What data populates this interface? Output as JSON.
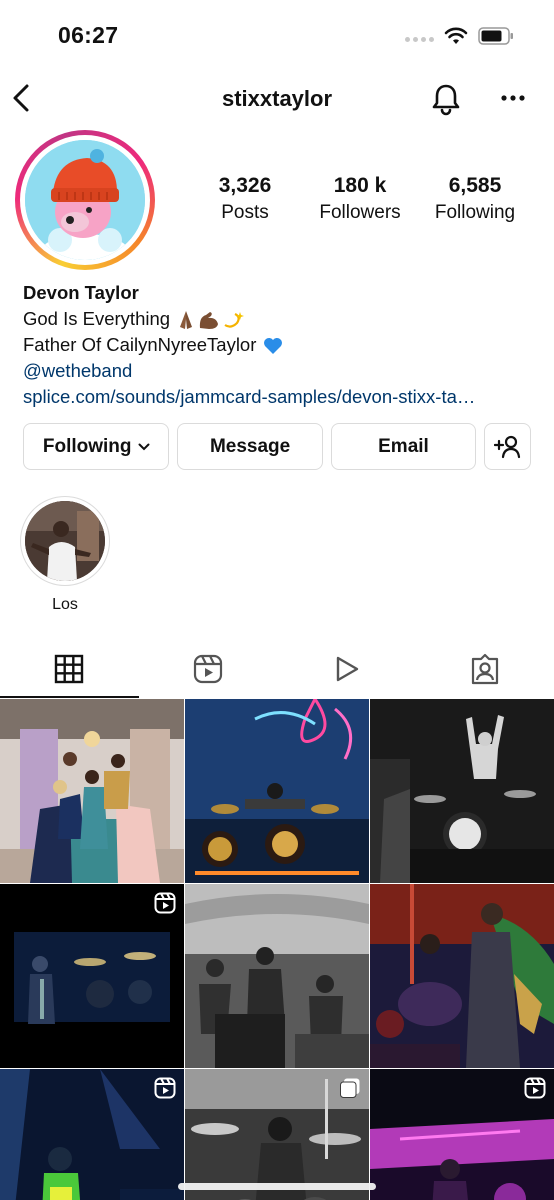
{
  "status_bar": {
    "time": "06:27"
  },
  "header": {
    "username": "stixxtaylor"
  },
  "stats": [
    {
      "value": "3,326",
      "label": "Posts"
    },
    {
      "value": "180 k",
      "label": "Followers"
    },
    {
      "value": "6,585",
      "label": "Following"
    }
  ],
  "bio": {
    "name": "Devon Taylor",
    "line1": "God Is Everything",
    "line2": "Father Of CailynNyreeTaylor",
    "mention": "@wetheband",
    "link": "splice.com/sounds/jammcard-samples/devon-stixx-ta…"
  },
  "buttons": {
    "following": "Following",
    "message": "Message",
    "email": "Email"
  },
  "highlights": [
    {
      "label": "Los"
    }
  ],
  "tabs": [
    "grid-icon",
    "reels-icon",
    "play-icon",
    "tagged-icon"
  ],
  "colors": {
    "link": "#00376b",
    "accent_ring": "#ee2a7b",
    "border": "#dbdbdb"
  },
  "grid_posts": [
    {
      "kind": "photo",
      "reel": false
    },
    {
      "kind": "photo",
      "reel": false
    },
    {
      "kind": "photo",
      "reel": false
    },
    {
      "kind": "reel",
      "reel": true
    },
    {
      "kind": "photo",
      "reel": false
    },
    {
      "kind": "photo",
      "reel": false
    },
    {
      "kind": "reel",
      "reel": true
    },
    {
      "kind": "photo",
      "reel": true
    },
    {
      "kind": "reel",
      "reel": true
    }
  ]
}
